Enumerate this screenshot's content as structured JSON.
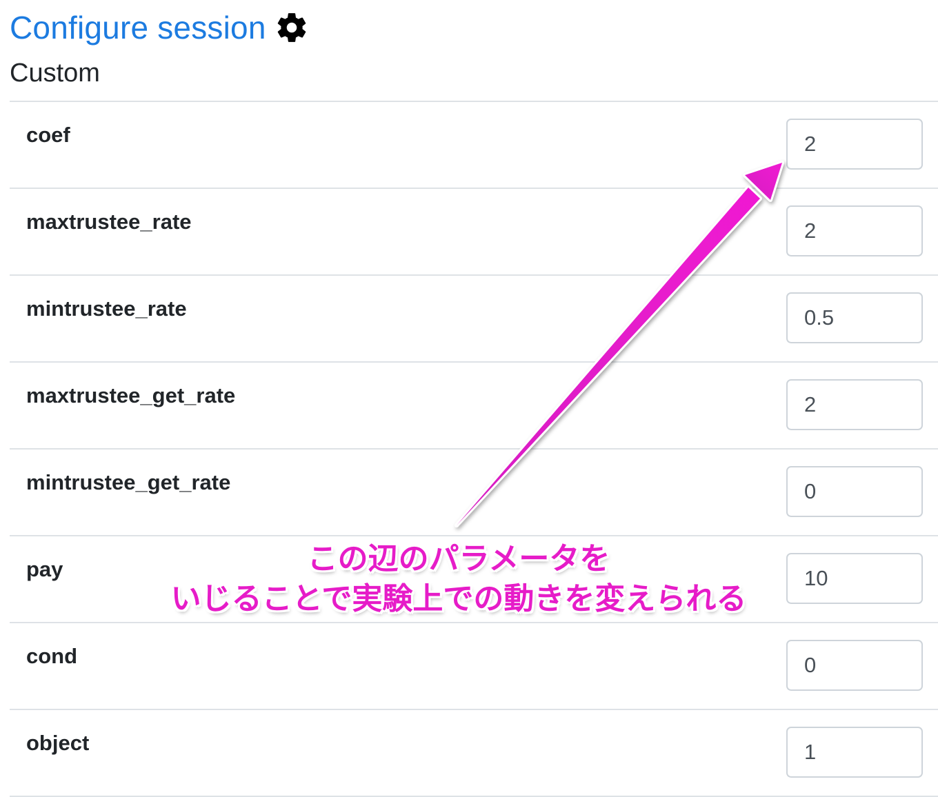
{
  "header": {
    "title": "Configure session",
    "subtitle": "Custom",
    "title_color": "#1c7be0",
    "icon": "gear-icon"
  },
  "fields": [
    {
      "key": "coef",
      "label": "coef",
      "value": "2"
    },
    {
      "key": "maxtrustee_rate",
      "label": "maxtrustee_rate",
      "value": "2"
    },
    {
      "key": "mintrustee_rate",
      "label": "mintrustee_rate",
      "value": "0.5"
    },
    {
      "key": "maxtrustee_get_rate",
      "label": "maxtrustee_get_rate",
      "value": "2"
    },
    {
      "key": "mintrustee_get_rate",
      "label": "mintrustee_get_rate",
      "value": "0"
    },
    {
      "key": "pay",
      "label": "pay",
      "value": "10"
    },
    {
      "key": "cond",
      "label": "cond",
      "value": "0"
    },
    {
      "key": "object",
      "label": "object",
      "value": "1"
    }
  ],
  "annotation": {
    "line1": "この辺のパラメータを",
    "line2": "いじることで実験上での動きを変えられる",
    "color": "#e61cc8",
    "arrow_icon": "arrow-icon"
  }
}
